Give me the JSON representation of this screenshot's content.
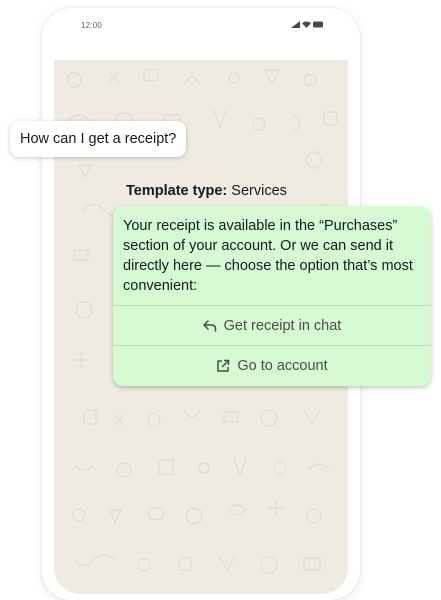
{
  "status_bar": {
    "time": "12:00",
    "icons": [
      "signal-icon",
      "wifi-icon",
      "battery-icon"
    ]
  },
  "chat": {
    "incoming_message": "How can I get a receipt?",
    "template": {
      "label": "Template type:",
      "value": "Services"
    },
    "outgoing_message": {
      "text": "Your receipt is available in the “Purchases” section of your account. Or we can send it directly here — choose the option that’s most convenient:",
      "buttons": [
        {
          "label": "Get receipt in chat",
          "icon": "reply-arrow-icon"
        },
        {
          "label": "Go to account",
          "icon": "external-link-icon"
        }
      ]
    }
  },
  "colors": {
    "chat_background": "#efeae2",
    "outgoing_bubble": "#d6fad2",
    "incoming_bubble": "#ffffff"
  }
}
